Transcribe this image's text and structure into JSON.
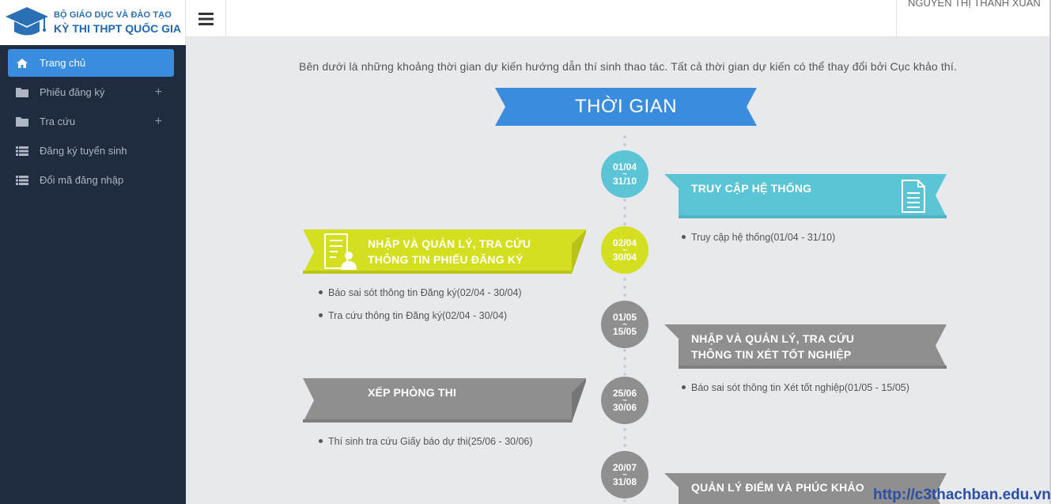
{
  "brand": {
    "line1": "BỘ GIÁO DỤC VÀ ĐÀO TẠO",
    "line2": "KỲ THI THPT QUỐC GIA",
    "logo_icon": "graduation-cap-icon",
    "color": "#2b6fb4"
  },
  "sidebar": {
    "items": [
      {
        "label": "Trang chủ",
        "icon": "home-icon",
        "active": true
      },
      {
        "label": "Phiếu đăng ký",
        "icon": "folder-icon",
        "expand": "+"
      },
      {
        "label": "Tra cứu",
        "icon": "folder-icon",
        "expand": "+"
      },
      {
        "label": "Đăng ký tuyển sinh",
        "icon": "list-icon"
      },
      {
        "label": "Đổi mã đăng nhập",
        "icon": "list-icon"
      }
    ]
  },
  "topbar": {
    "user_name": "NGUYỄN THỊ THANH XUÂN"
  },
  "content": {
    "intro": "Bên dưới là những khoảng thời gian dự kiến hướng dẫn thí sinh thao tác. Tất cả thời gian dự kiến có thể thay đổi bởi Cục khảo thí.",
    "title": "THỜI GIAN"
  },
  "timeline": [
    {
      "start": "01/04",
      "end": "31/10",
      "sep": "~",
      "title": [
        "TRUY CẬP HỆ THỐNG"
      ],
      "icon": "document-icon",
      "items": [
        "Truy cập hệ thống(01/04 - 31/10)"
      ]
    },
    {
      "start": "02/04",
      "end": "30/04",
      "sep": "~",
      "title": [
        "NHẬP VÀ QUẢN LÝ, TRA CỨU",
        "THÔNG TIN PHIẾU ĐĂNG KÝ"
      ],
      "icon": "user-form-icon",
      "items": [
        "Báo sai sót thông tin Đăng ký(02/04 - 30/04)",
        "Tra cứu thông tin Đăng ký(02/04 - 30/04)"
      ]
    },
    {
      "start": "01/05",
      "end": "15/05",
      "sep": "~",
      "title": [
        "NHẬP VÀ QUẢN LÝ, TRA CỨU",
        "THÔNG TIN XÉT TỐT NGHIỆP"
      ],
      "items": [
        "Báo sai sót thông tin Xét tốt nghiệp(01/05 - 15/05)"
      ]
    },
    {
      "start": "25/06",
      "end": "30/06",
      "sep": "~",
      "title": [
        "XẾP PHÒNG THI"
      ],
      "items": [
        "Thí sinh tra cứu Giấy báo dự thi(25/06 - 30/06)"
      ]
    },
    {
      "start": "20/07",
      "end": "31/08",
      "sep": "~",
      "title": [
        "QUẢN LÝ ĐIỂM VÀ PHÚC KHẢO"
      ],
      "items": []
    }
  ],
  "colors": {
    "cyan": "#5bc4d5",
    "yellow": "#d4df20",
    "gray": "#8f8f8f",
    "blue": "#3a8dde",
    "sidebar": "#1f2b3e"
  },
  "watermark": "http://c3thachban.edu.vn"
}
